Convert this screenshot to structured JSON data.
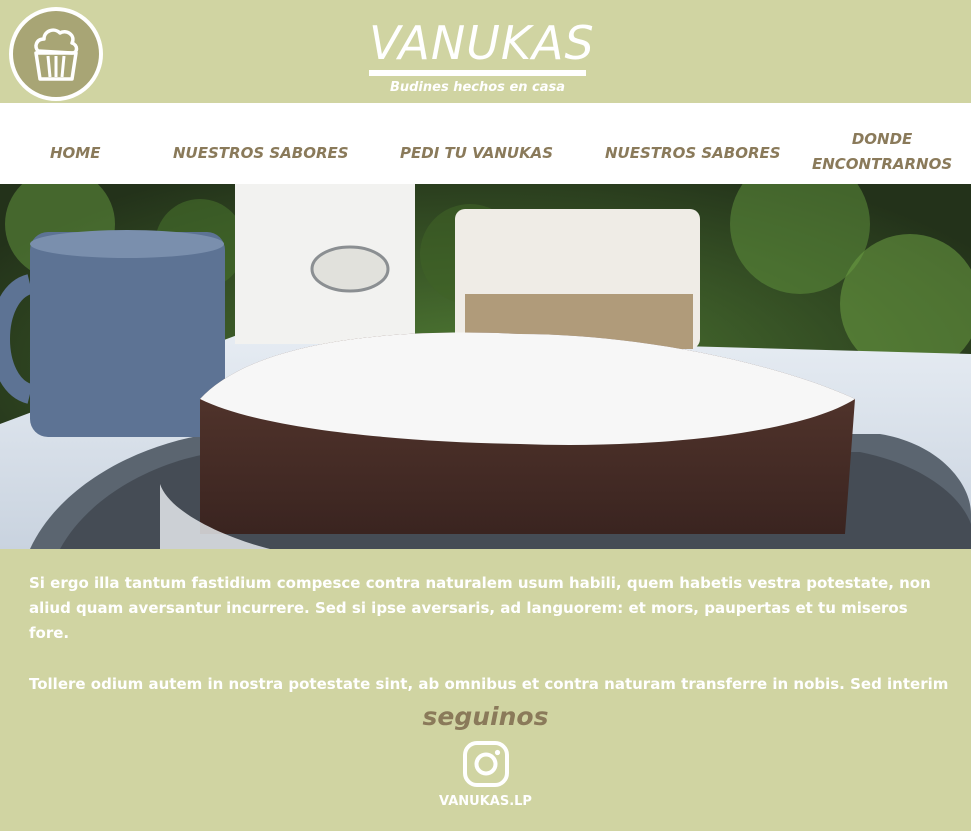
{
  "brand": {
    "name": "VANUKAS",
    "tagline": "Budines hechos en casa",
    "logo_icon": "cupcake-icon"
  },
  "nav": {
    "items": [
      {
        "label": "HOME"
      },
      {
        "label": "NUESTROS SABORES"
      },
      {
        "label": "PEDI TU VANUKAS"
      },
      {
        "label": "NUESTROS SABORES"
      },
      {
        "label_line1": "DONDE",
        "label_line2": "ENCONTRARNOS"
      }
    ]
  },
  "hero": {
    "image_icon": "hero-photo"
  },
  "content": {
    "paragraph1": "Si ergo illa tantum fastidium compesce contra naturalem usum habili, quem habetis vestra potestate, non aliud quam aversantur incurrere. Sed si ipse aversaris, ad languorem: et mors, paupertas et tu miseros fore.",
    "paragraph2": "Tollere odium autem in nostra potestate sint, ab omnibus et contra naturam transferre in nobis. Sed interim"
  },
  "social": {
    "label": "seguinos",
    "icon": "instagram-icon",
    "handle": "VANUKAS.LP"
  },
  "colors": {
    "background": "#d0d4a2",
    "nav_background": "#ffffff",
    "nav_text": "#8a7a5a",
    "logo_badge": "#a8a575",
    "text": "#ffffff"
  }
}
